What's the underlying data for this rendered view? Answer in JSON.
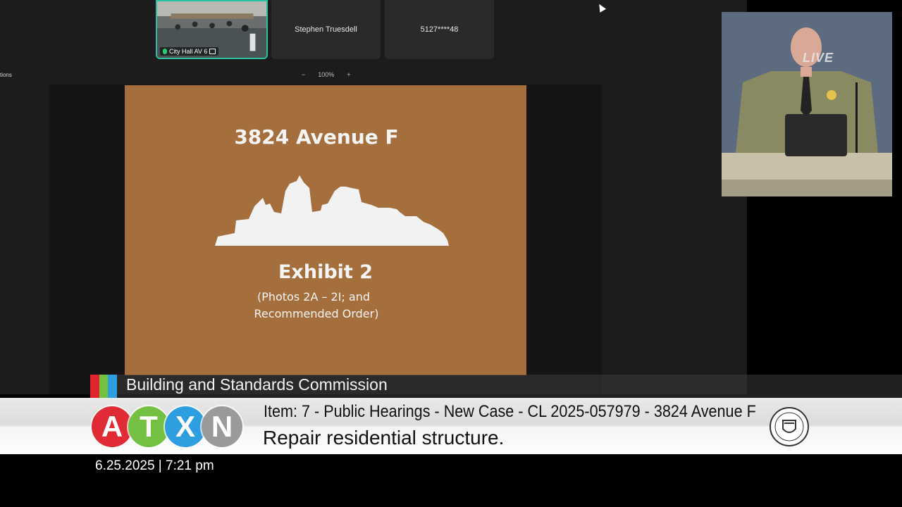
{
  "meeting": {
    "tiles": [
      {
        "caption": "City Hall AV 6"
      },
      {
        "name": "Stephen Truesdell"
      },
      {
        "name": "5127****48"
      }
    ],
    "left_label": "tions",
    "zoom": {
      "minus": "−",
      "level": "100%",
      "plus": "+"
    }
  },
  "slide": {
    "title": "3824 Avenue F",
    "exhibit": "Exhibit 2",
    "line1": "(Photos 2A – 2I; and",
    "line2": "Recommended Order)",
    "background": "#a56e3d"
  },
  "live_feed": {
    "badge": "LIVE"
  },
  "broadcast": {
    "commission": "Building and Standards Commission",
    "logo_letters": [
      "A",
      "T",
      "X",
      "N"
    ],
    "logo_colors": [
      "#e02b36",
      "#74c043",
      "#2d9ee0",
      "#9a9a9a"
    ],
    "ticks_colors": [
      "#e0252e",
      "#74c043",
      "#2d9ee0"
    ],
    "item": "Item: 7 - Public Hearings - New Case - CL 2025-057979 - 3824 Avenue F",
    "description": "Repair residential structure.",
    "timestamp": "6.25.2025 | 7:21 pm"
  }
}
